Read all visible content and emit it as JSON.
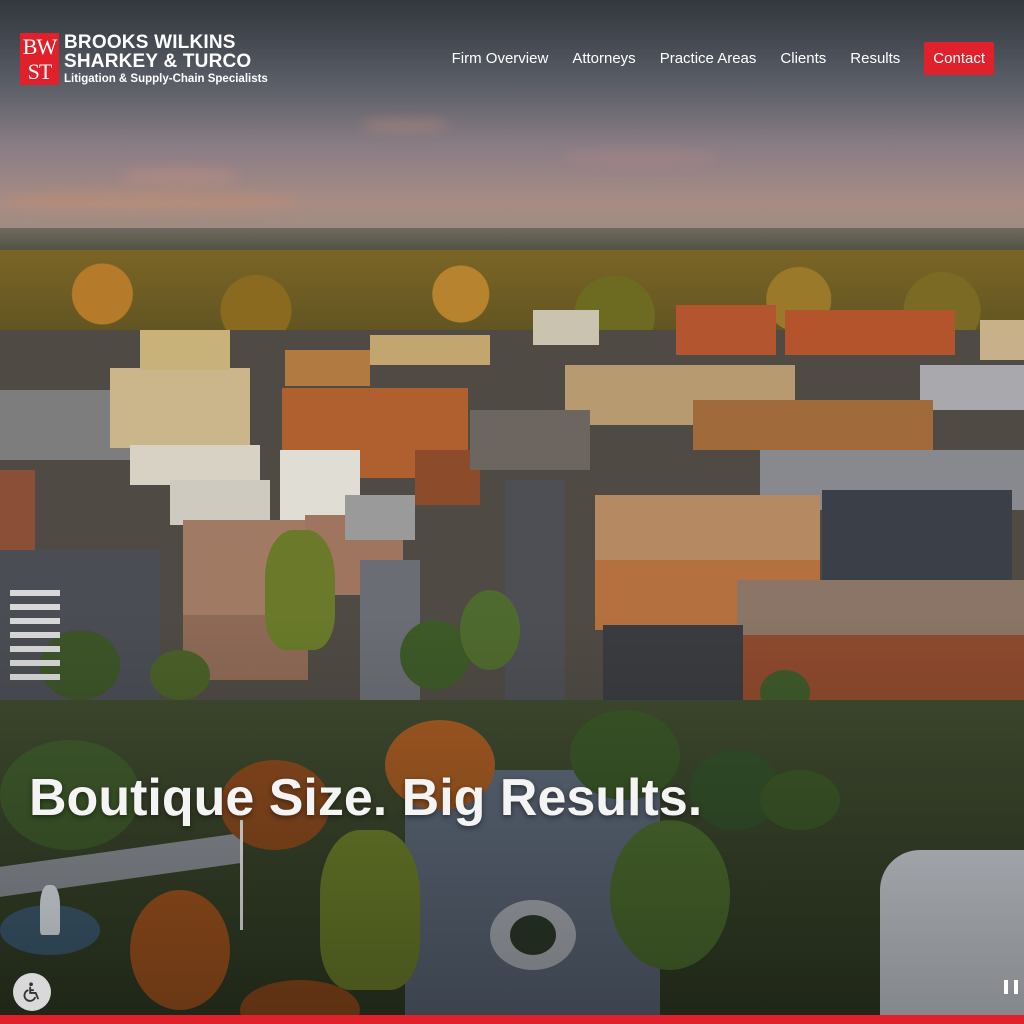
{
  "brand": {
    "mark_rows": [
      "BW",
      "ST"
    ],
    "name_line1": "BROOKS WILKINS",
    "name_line2": "SHARKEY & TURCO",
    "tagline": "Litigation & Supply-Chain Specialists",
    "accent_color": "#e0202a"
  },
  "nav": {
    "items": [
      {
        "label": "Firm Overview"
      },
      {
        "label": "Attorneys"
      },
      {
        "label": "Practice Areas"
      },
      {
        "label": "Clients"
      },
      {
        "label": "Results"
      }
    ],
    "contact_label": "Contact"
  },
  "hero": {
    "headline": "Boutique Size. Big Results.",
    "background": "aerial-city-sunset-video"
  },
  "controls": {
    "accessibility_icon": "wheelchair-icon",
    "pause_icon": "pause-icon"
  }
}
